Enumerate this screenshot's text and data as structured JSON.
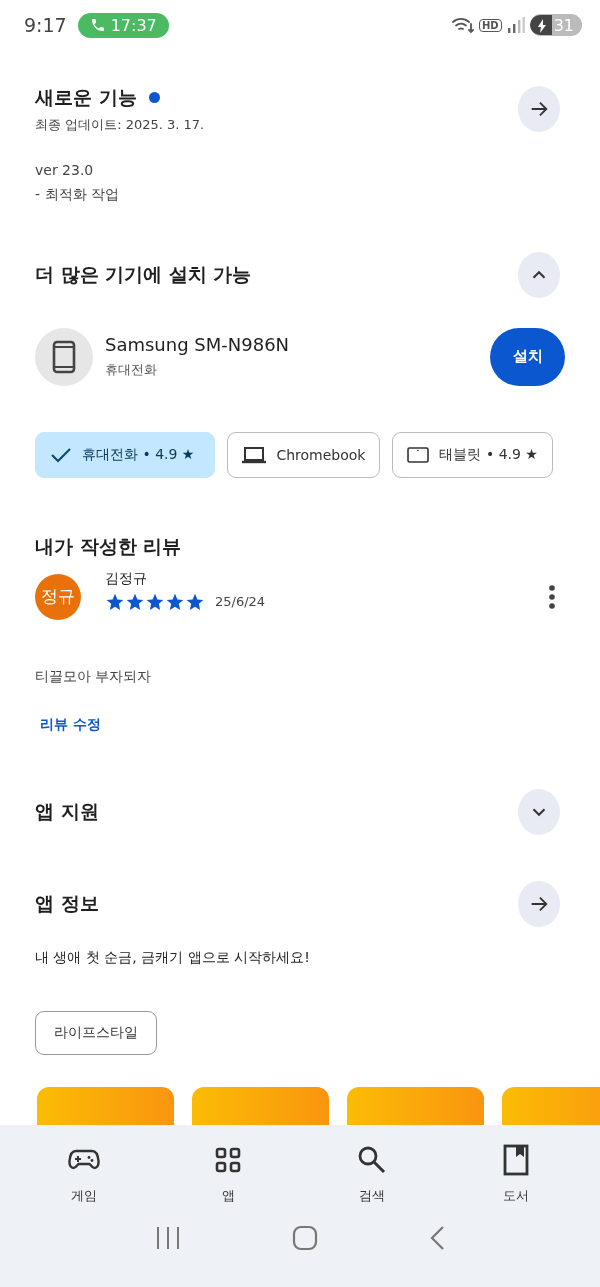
{
  "status_bar": {
    "time": "9:17",
    "call_time": "17:37",
    "hd_label": "HD",
    "battery": "31"
  },
  "whats_new": {
    "title": "새로운 기능",
    "new_dot": true,
    "updated": "최종 업데이트: 2025. 3. 17.",
    "notes": [
      "ver 23.0",
      "- 최적화 작업"
    ]
  },
  "devices": {
    "title": "더 많은 기기에 설치 가능",
    "expanded": true,
    "device_name": "Samsung SM-N986N",
    "device_type": "휴대전화",
    "install_button": "설치",
    "chips": [
      {
        "label": "휴대전화 • 4.9 ★",
        "selected": true
      },
      {
        "kind": "laptop",
        "label": "Chromebook",
        "selected": false
      },
      {
        "kind": "tablet",
        "label": "태블릿 • 4.9 ★",
        "selected": false
      }
    ]
  },
  "my_review": {
    "title": "내가 작성한 리뷰",
    "avatar": "정규",
    "author": "김정규",
    "stars": 5,
    "date": "25/6/24",
    "text": "티끌모아 부자되자",
    "edit_link": "리뷰 수정"
  },
  "app_support": {
    "title": "앱 지원",
    "expanded": false
  },
  "app_info": {
    "title": "앱 정보",
    "description": "내 생애 첫 순금, 금캐기 앱으로 시작하세요!",
    "tag": "라이프스타일"
  },
  "bottom_nav": [
    {
      "kind": "games",
      "label": "게임",
      "selected": false
    },
    {
      "kind": "apps",
      "label": "앱",
      "selected": false
    },
    {
      "kind": "search",
      "label": "검색",
      "selected": false
    },
    {
      "kind": "books",
      "label": "도서",
      "selected": false
    }
  ]
}
